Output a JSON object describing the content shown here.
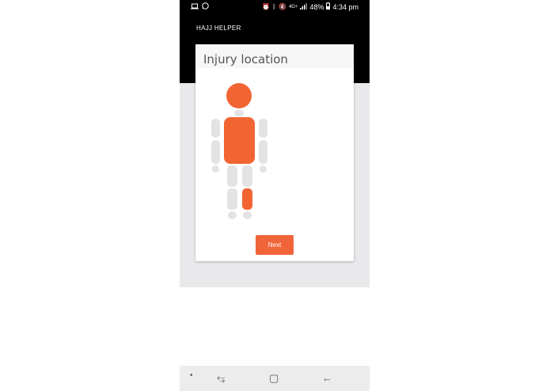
{
  "status_bar": {
    "notification_icons": [
      "laptop-icon",
      "whatsapp-icon"
    ],
    "system_icons": [
      "alarm-icon",
      "bluetooth-icon",
      "mute-icon",
      "signal-icon"
    ],
    "network": "4G+",
    "battery": "48%",
    "time": "4:34 pm"
  },
  "app_bar": {
    "title": "HAJJ HELPER"
  },
  "card": {
    "title": "Injury location",
    "next_label": "Next"
  },
  "body_map": {
    "selected_parts": [
      "head",
      "torso",
      "left-lower-leg"
    ],
    "colors": {
      "selected": "#f26533",
      "unselected": "#e3e3e3"
    }
  },
  "nav_bar": {
    "items": [
      "recent-apps-icon",
      "home-icon",
      "back-icon"
    ],
    "dot": "•",
    "recent_glyph": "⥃",
    "home_glyph": "▢",
    "back_glyph": "←"
  },
  "colors": {
    "app_bar": "#000000",
    "accent": "#f0643a",
    "background": "#e9e9ec"
  }
}
